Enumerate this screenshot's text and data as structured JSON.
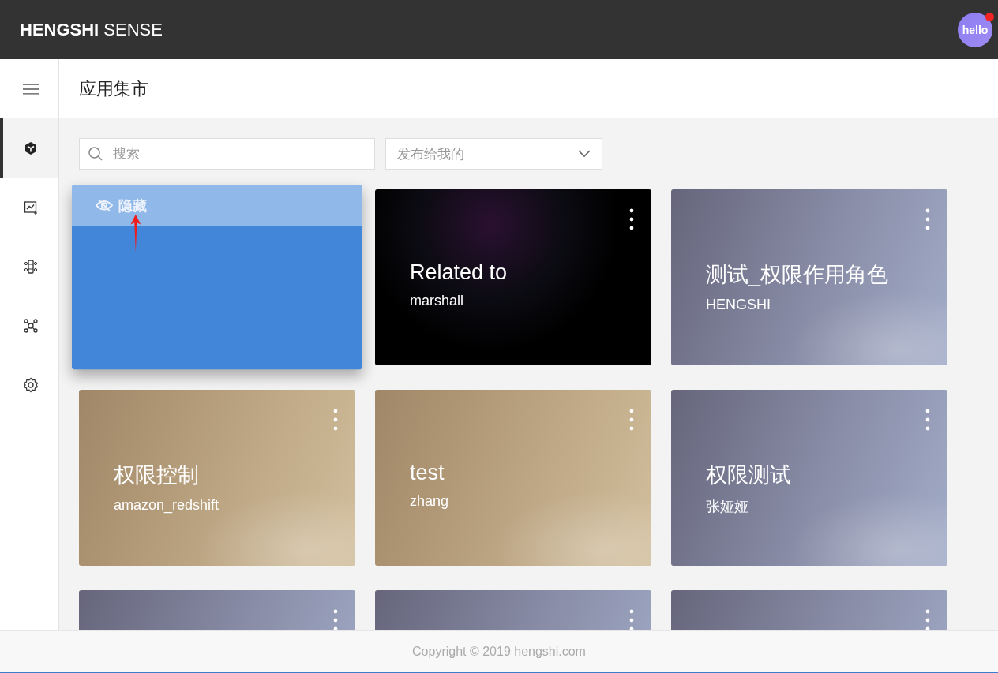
{
  "header": {
    "brand": "**HENGSHI** SENSE",
    "avatar": {
      "label": "hello",
      "notification": true
    }
  },
  "sidebar": {
    "items": [
      {
        "kind": "cube",
        "selected": true
      },
      {
        "kind": "chart",
        "selected": false
      },
      {
        "kind": "dataset",
        "selected": false
      },
      {
        "kind": "network",
        "selected": false
      },
      {
        "kind": "settings",
        "selected": false
      }
    ]
  },
  "page_title": "应用集市",
  "search": {
    "placeholder": "搜索"
  },
  "filter": {
    "value": "发布给我的"
  },
  "cards": [
    {
      "kind": "dragging",
      "overlay_label": "隐藏"
    },
    {
      "kind": "swirl",
      "title": "Related to",
      "subtitle": "marshall"
    },
    {
      "kind": "slate",
      "title": "测试_权限作用角色",
      "subtitle": "HENGSHI"
    },
    {
      "kind": "sand",
      "title": "权限控制",
      "subtitle": "amazon_redshift"
    },
    {
      "kind": "sand",
      "title": "test",
      "subtitle": "zhang"
    },
    {
      "kind": "slate",
      "title": "权限测试",
      "subtitle": "张娅娅"
    },
    {
      "kind": "slate"
    },
    {
      "kind": "slate"
    },
    {
      "kind": "slate"
    }
  ],
  "footer": "Copyright © 2019 hengshi.com"
}
